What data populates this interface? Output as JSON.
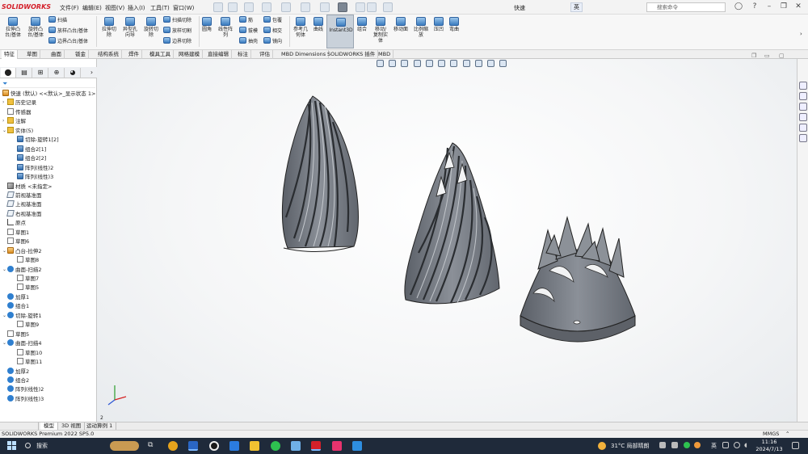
{
  "app": {
    "logo": "SOLIDWORKS",
    "document_title": "快速",
    "search_placeholder": "搜索命令",
    "ime": "英"
  },
  "menus": [
    "文件(F)",
    "编辑(E)",
    "视图(V)",
    "插入(I)",
    "工具(T)",
    "窗口(W)"
  ],
  "ribbon": {
    "large": [
      {
        "id": "extrude-boss",
        "label": "拉伸凸\n台/基体",
        "icon": "extrude-boss-icon"
      },
      {
        "id": "revolve-boss",
        "label": "旋转凸\n台/基体",
        "icon": "revolve-boss-icon"
      },
      {
        "id": "extrude-cut",
        "label": "拉伸切\n除",
        "icon": "extrude-cut-icon"
      },
      {
        "id": "hole-wizard",
        "label": "异型孔\n向导",
        "icon": "hole-wizard-icon"
      },
      {
        "id": "revolve-cut",
        "label": "旋转切\n除",
        "icon": "revolve-cut-icon"
      },
      {
        "id": "fillet",
        "label": "圆角",
        "icon": "fillet-icon"
      },
      {
        "id": "linear-pattern",
        "label": "线性阵\n列",
        "icon": "linear-pattern-icon"
      },
      {
        "id": "ref-geometry",
        "label": "参考几\n何体",
        "icon": "ref-geometry-icon"
      },
      {
        "id": "curves",
        "label": "曲线",
        "icon": "curves-icon"
      },
      {
        "id": "instant3d",
        "label": "Instant3D",
        "icon": "instant3d-icon"
      },
      {
        "id": "combine",
        "label": "组合",
        "icon": "combine-icon"
      },
      {
        "id": "move-copy",
        "label": "移动/\n复制实\n体",
        "icon": "move-copy-icon"
      },
      {
        "id": "move-face",
        "label": "移动面",
        "icon": "move-face-icon"
      },
      {
        "id": "scale",
        "label": "比例缩\n放",
        "icon": "scale-icon"
      },
      {
        "id": "indent",
        "label": "压凹",
        "icon": "indent-icon"
      },
      {
        "id": "flex",
        "label": "弯曲",
        "icon": "flex-icon"
      }
    ],
    "small": [
      {
        "id": "sweep",
        "label": "扫描",
        "icon": "sweep-icon"
      },
      {
        "id": "loft",
        "label": "放样凸台/基体",
        "icon": "loft-icon"
      },
      {
        "id": "boundary",
        "label": "边界凸台/基体",
        "icon": "boundary-icon"
      },
      {
        "id": "sweep-cut",
        "label": "扫描切除",
        "icon": "sweep-cut-icon"
      },
      {
        "id": "loft-cut",
        "label": "放样切割",
        "icon": "loft-cut-icon"
      },
      {
        "id": "boundary-cut",
        "label": "边界切除",
        "icon": "boundary-cut-icon"
      },
      {
        "id": "rib",
        "label": "筋",
        "icon": "rib-icon"
      },
      {
        "id": "draft",
        "label": "拔模",
        "icon": "draft-icon"
      },
      {
        "id": "shell",
        "label": "抽壳",
        "icon": "shell-icon"
      },
      {
        "id": "wrap",
        "label": "包覆",
        "icon": "wrap-icon"
      },
      {
        "id": "intersect",
        "label": "相交",
        "icon": "intersect-icon"
      },
      {
        "id": "mirror",
        "label": "镜向",
        "icon": "mirror-icon"
      }
    ]
  },
  "command_tabs": [
    "特征",
    "草图",
    "曲面",
    "钣金",
    "结构系统",
    "焊件",
    "模具工具",
    "网格建模",
    "直接编辑",
    "标注",
    "评估",
    "MBD Dimensions",
    "SOLIDWORKS 插件",
    "MBD"
  ],
  "tree": {
    "root": "快速 (默认) <<默认>_显示状态 1>",
    "items": [
      "历史记录",
      "传感器",
      "注解",
      "实体(5)",
      "切除-旋转1[2]",
      "组合2[1]",
      "组合2[2]",
      "阵列(线性)2",
      "阵列(线性)3",
      "材质 <未指定>",
      "前视基准面",
      "上视基准面",
      "右视基准面",
      "原点",
      "草图1",
      "草图6",
      "凸台-拉伸2",
      "草图8",
      "曲面-扫描2",
      "草图7",
      "草图5",
      "加厚1",
      "组合1",
      "切除-旋转1",
      "草图9",
      "草图5",
      "曲面-扫描4",
      "草图10",
      "草图11",
      "加厚2",
      "组合2",
      "阵列(线性)2",
      "阵列(线性)3"
    ]
  },
  "viewport": {
    "triad_label": "2",
    "view_note": "isometric"
  },
  "bottom_tabs": [
    "模型",
    "3D 视图",
    "运动算例 1"
  ],
  "status": {
    "left": "SOLIDWORKS Premium 2022 SP5.0",
    "units": "MMGS"
  },
  "taskbar": {
    "search": "搜索",
    "weather": "31°C 局部晴朗",
    "tray": "英",
    "time": "11:16",
    "date": "2024/7/13"
  },
  "colors": {
    "brand": "#d4202a",
    "accent": "#2f7fcf",
    "model": "#6f747b"
  }
}
